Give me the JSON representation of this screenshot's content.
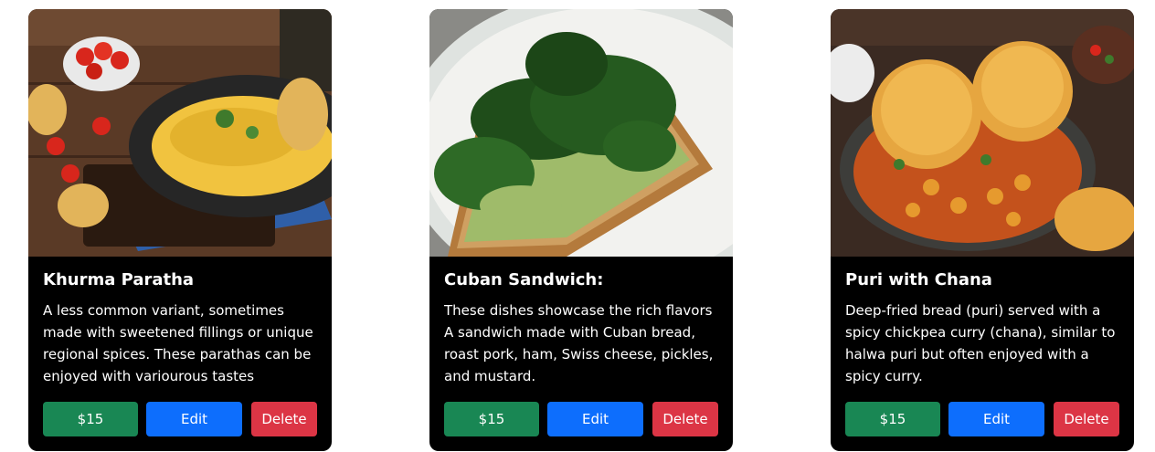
{
  "cards": [
    {
      "title": "Khurma Paratha",
      "description": "A less common variant, sometimes made with sweetened fillings or unique regional spices. These parathas can be enjoyed with variourous tastes",
      "price_label": "$15",
      "edit_label": "Edit",
      "delete_label": "Delete"
    },
    {
      "title": "Cuban Sandwich:",
      "description": "These dishes showcase the rich flavors A sandwich made with Cuban bread, roast pork, ham, Swiss cheese, pickles, and mustard.",
      "price_label": "$15",
      "edit_label": "Edit",
      "delete_label": "Delete"
    },
    {
      "title": "Puri with Chana",
      "description": "Deep-fried bread (puri) served with a spicy chickpea curry (chana), similar to halwa puri but often enjoyed with a spicy curry.",
      "price_label": "$15",
      "edit_label": "Edit",
      "delete_label": "Delete"
    }
  ],
  "colors": {
    "card_bg": "#000000",
    "price_button": "#198754",
    "edit_button": "#0d6efd",
    "delete_button": "#dc3545"
  }
}
